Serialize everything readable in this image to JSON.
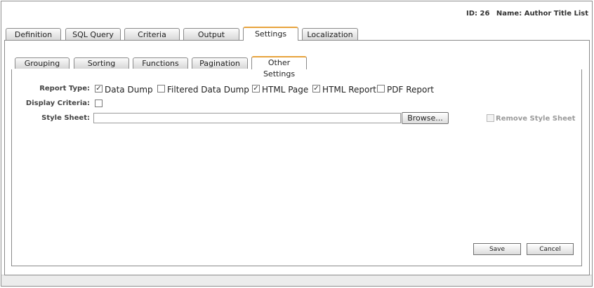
{
  "header": {
    "id_label": "ID:",
    "id_value": "26",
    "name_label": "Name:",
    "name_value": "Author Title List"
  },
  "tabs": [
    {
      "label": "Definition",
      "active": false
    },
    {
      "label": "SQL Query",
      "active": false
    },
    {
      "label": "Criteria",
      "active": false
    },
    {
      "label": "Output",
      "active": false
    },
    {
      "label": "Settings",
      "active": true
    },
    {
      "label": "Localization",
      "active": false
    }
  ],
  "subtabs": [
    {
      "label": "Grouping",
      "active": false
    },
    {
      "label": "Sorting",
      "active": false
    },
    {
      "label": "Functions",
      "active": false
    },
    {
      "label": "Pagination",
      "active": false
    },
    {
      "label": "Other Settings",
      "active": true
    }
  ],
  "form": {
    "report_type_label": "Report Type:",
    "report_types": [
      {
        "label": "Data Dump",
        "checked": true
      },
      {
        "label": "Filtered Data Dump",
        "checked": false
      },
      {
        "label": "HTML Page",
        "checked": true
      },
      {
        "label": "HTML Report",
        "checked": true
      },
      {
        "label": "PDF Report",
        "checked": false
      }
    ],
    "display_criteria_label": "Display Criteria:",
    "display_criteria_checked": false,
    "style_sheet_label": "Style Sheet:",
    "style_sheet_value": "",
    "browse_label": "Browse...",
    "remove_style_sheet_label": "Remove Style Sheet",
    "remove_style_sheet_enabled": false
  },
  "actions": {
    "save_label": "Save",
    "cancel_label": "Cancel"
  },
  "colors": {
    "active_tab_accent": "#e8a33c",
    "border": "#8a8a8a"
  }
}
